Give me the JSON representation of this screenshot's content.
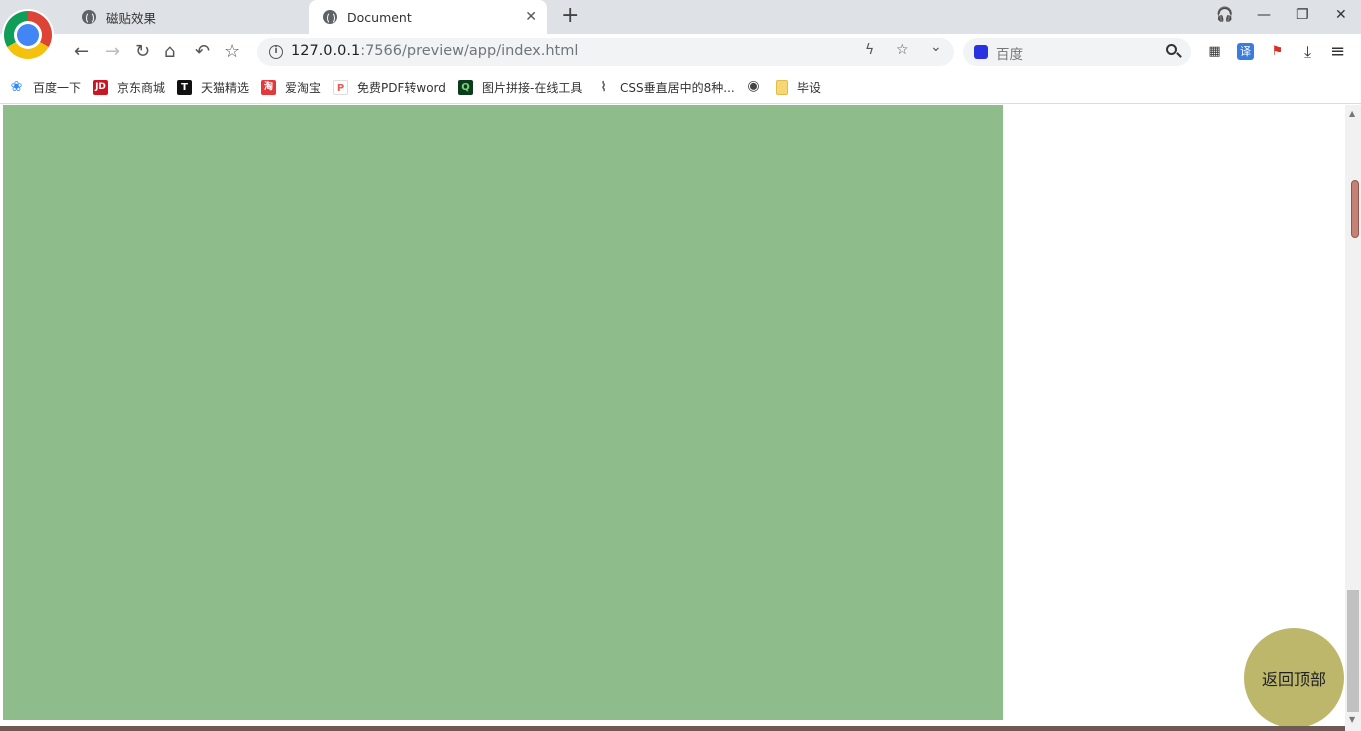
{
  "tabs": [
    {
      "title": "磁贴效果",
      "active": false
    },
    {
      "title": "Document",
      "active": true
    }
  ],
  "tab_close": "✕",
  "new_tab": "+",
  "window_controls": {
    "headset": "🎧",
    "minimize": "—",
    "restore": "❐",
    "close": "✕"
  },
  "nav": {
    "back": "←",
    "forward": "→",
    "reload": "↻",
    "home": "⌂",
    "undo": "↶",
    "star": "☆"
  },
  "address": {
    "host": "127.0.0.1",
    "rest": ":7566/preview/app/index.html",
    "info": "i"
  },
  "omnibox_icons": {
    "bolt": "ϟ",
    "star": "☆",
    "dropdown": "⌄"
  },
  "search": {
    "placeholder": "百度"
  },
  "extensions": {
    "qr": "▦",
    "translate": "译",
    "pdf": "⚑",
    "download": "⤓",
    "menu": "≡"
  },
  "bookmarks": [
    {
      "label": "百度一下",
      "icon": "baidu-paw-icon",
      "badge": "❀",
      "color": "#3388ff"
    },
    {
      "label": "京东商城",
      "icon": "jd-icon",
      "badge": "JD",
      "color": "#c81623"
    },
    {
      "label": "天猫精选",
      "icon": "tmall-icon",
      "badge": "T",
      "color": "#111111"
    },
    {
      "label": "爱淘宝",
      "icon": "taobao-icon",
      "badge": "淘",
      "color": "#e4393c"
    },
    {
      "label": "免费PDF转word",
      "icon": "pdf-icon",
      "badge": "P",
      "color": "#e85a4f"
    },
    {
      "label": "图片拼接-在线工具",
      "icon": "image-tool-icon",
      "badge": "Q",
      "color": "#0a3d1c"
    },
    {
      "label": "CSS垂直居中的8种...",
      "icon": "css-icon",
      "badge": "⌇",
      "color": "#666666"
    },
    {
      "label": "",
      "icon": "globe-icon",
      "badge": "◉",
      "color": "#444444"
    },
    {
      "label": "毕设",
      "icon": "folder-icon",
      "badge": "",
      "color": "#f7d774"
    }
  ],
  "page": {
    "block_color": "#8fbc8b",
    "back_to_top": "返回顶部",
    "back_to_top_color": "#bdb76b"
  },
  "scrollbar": {
    "up": "▲",
    "down": "▼"
  }
}
